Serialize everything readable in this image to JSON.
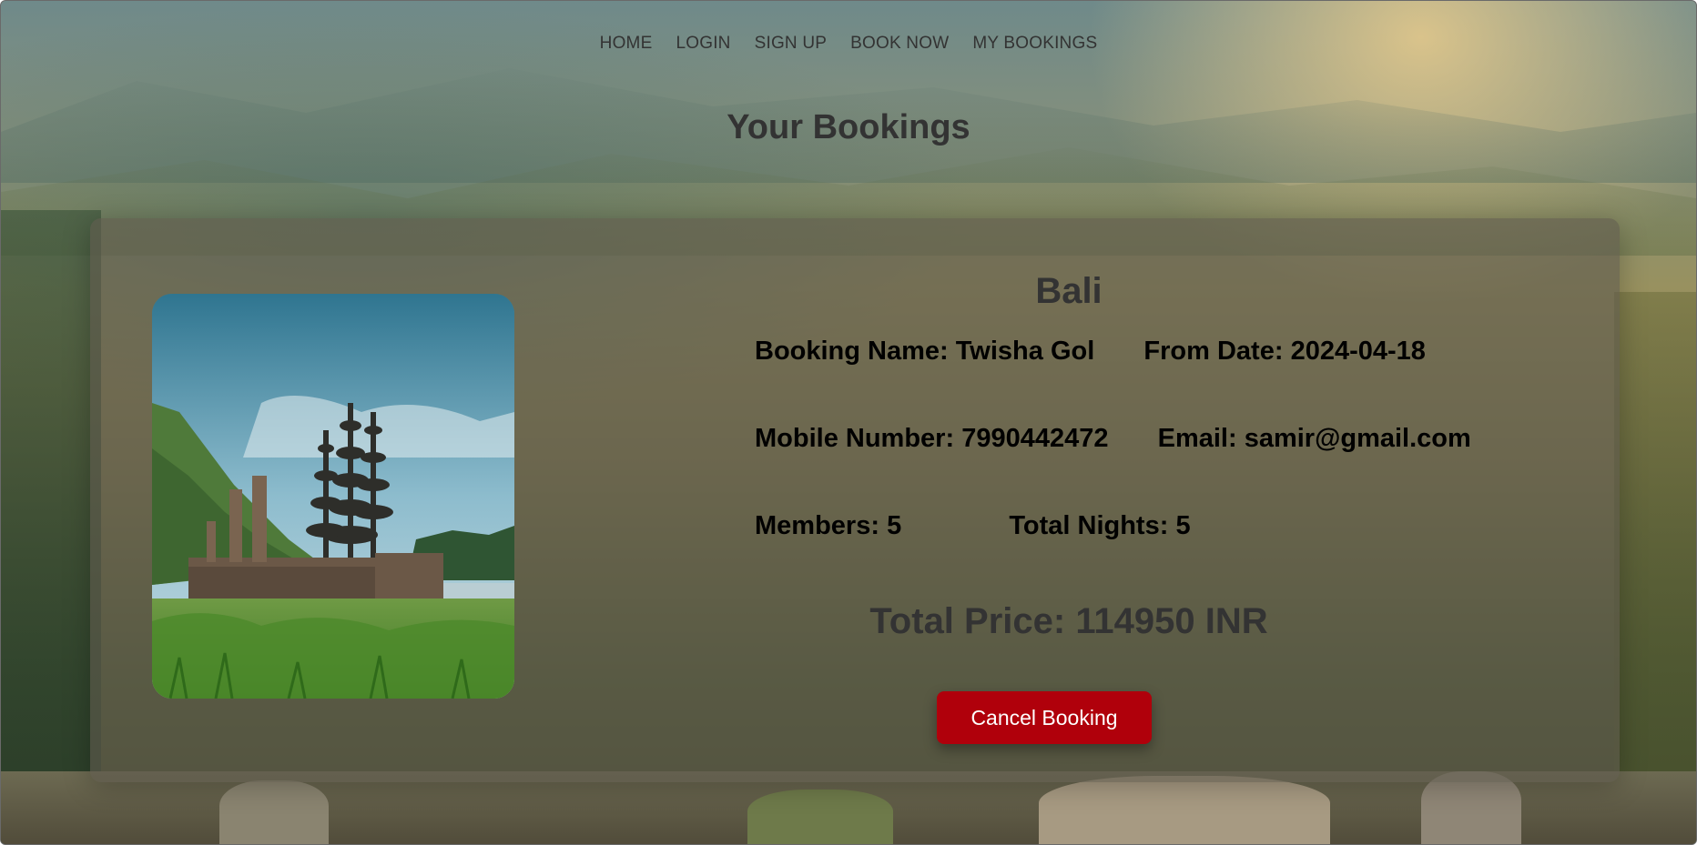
{
  "nav": {
    "items": [
      {
        "label": "HOME"
      },
      {
        "label": "LOGIN"
      },
      {
        "label": "SIGN UP"
      },
      {
        "label": "BOOK NOW"
      },
      {
        "label": "MY BOOKINGS"
      }
    ]
  },
  "page": {
    "title": "Your Bookings"
  },
  "booking": {
    "destination": "Bali",
    "booking_name_label": "Booking Name:",
    "booking_name": "Twisha Gol",
    "from_date_label": "From Date:",
    "from_date": "2024-04-18",
    "mobile_label": "Mobile Number:",
    "mobile": "7990442472",
    "email_label": "Email:",
    "email": "samir@gmail.com",
    "members_label": "Members:",
    "members": "5",
    "nights_label": "Total Nights:",
    "nights": "5",
    "price_label": "Total Price:",
    "price": "114950",
    "currency": "INR",
    "cancel_label": "Cancel Booking",
    "image_icon": "bali-temple-photo"
  },
  "colors": {
    "cancel_button": "#b0000b",
    "heading_text": "#333333"
  }
}
